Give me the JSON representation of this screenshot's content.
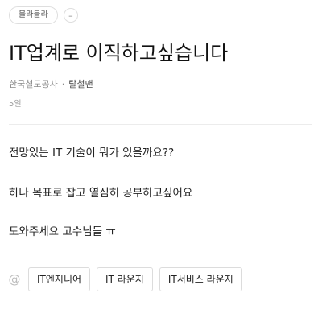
{
  "category": {
    "label": "블라블라"
  },
  "more_button": {
    "label": "–"
  },
  "post": {
    "title": "IT업계로 이직하고싶습니다",
    "company": "한국철도공사",
    "separator": "·",
    "author": "탈철맨",
    "date": "5일",
    "body_lines": [
      "전망있는 IT 기술이 뭐가 있을까요??",
      "하나 목표로 잡고 열심히 공부하고싶어요",
      "도와주세요 고수님들 ㅠ"
    ]
  },
  "tags": {
    "icon": "at-icon",
    "icon_glyph": "@",
    "items": [
      "IT엔지니어",
      "IT 라운지",
      "IT서비스 라운지"
    ]
  }
}
